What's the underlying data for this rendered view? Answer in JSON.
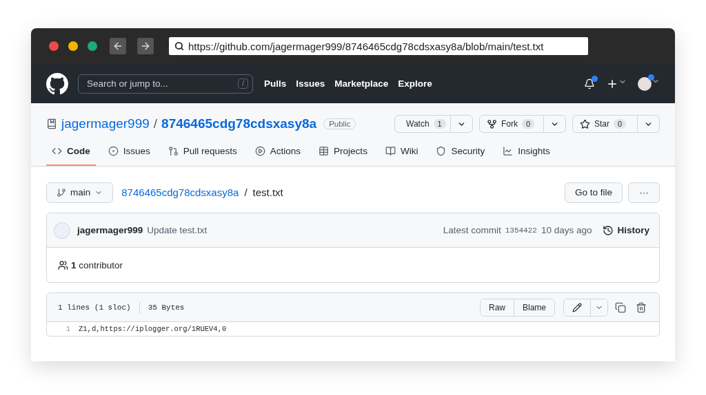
{
  "browser": {
    "url": "https://github.com/jagermager999/8746465cdg78cdsxasy8a/blob/main/test.txt"
  },
  "header": {
    "search_placeholder": "Search or jump to...",
    "slash_key": "/",
    "nav": [
      "Pulls",
      "Issues",
      "Marketplace",
      "Explore"
    ],
    "notifications_unread": true
  },
  "repo": {
    "owner": "jagermager999",
    "name": "8746465cdg78cdsxasy8a",
    "separator": "/",
    "visibility": "Public",
    "actions": [
      {
        "label": "Watch",
        "count": "1",
        "kind": "watch"
      },
      {
        "label": "Fork",
        "count": "0",
        "kind": "fork"
      },
      {
        "label": "Star",
        "count": "0",
        "kind": "star"
      }
    ]
  },
  "tabs": [
    {
      "label": "Code",
      "kind": "code",
      "selected": true
    },
    {
      "label": "Issues",
      "kind": "issues",
      "selected": false
    },
    {
      "label": "Pull requests",
      "kind": "pulls",
      "selected": false
    },
    {
      "label": "Actions",
      "kind": "actions",
      "selected": false
    },
    {
      "label": "Projects",
      "kind": "projects",
      "selected": false
    },
    {
      "label": "Wiki",
      "kind": "wiki",
      "selected": false
    },
    {
      "label": "Security",
      "kind": "security",
      "selected": false
    },
    {
      "label": "Insights",
      "kind": "insights",
      "selected": false
    }
  ],
  "file_nav": {
    "branch": "main",
    "repo_link": "8746465cdg78cdsxasy8a",
    "separator": "/",
    "file": "test.txt",
    "go_to_file": "Go to file",
    "more": "···"
  },
  "commit": {
    "author": "jagermager999",
    "message": "Update test.txt",
    "latest_label": "Latest commit",
    "sha": "1354422",
    "time": "10 days ago",
    "history": "History",
    "contributors": "**1** contributor"
  },
  "file": {
    "lines_info": "1 lines (1 sloc)",
    "size": "35 Bytes",
    "raw": "Raw",
    "blame": "Blame",
    "lines": [
      {
        "number": "1",
        "text": "Z1,d,https://iplogger.org/1RUEV4,0"
      }
    ]
  }
}
